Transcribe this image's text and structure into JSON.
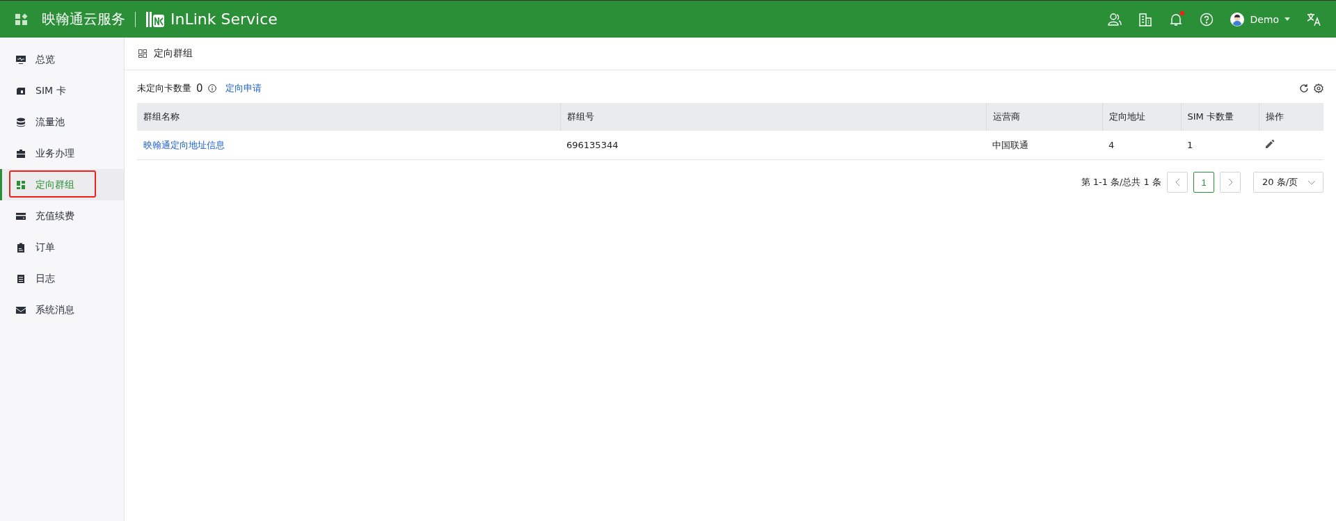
{
  "header": {
    "brand_cn": "映翰通云服务",
    "brand_en": "InLink Service",
    "notification_unread": true,
    "user": "Demo"
  },
  "sidebar": {
    "items": [
      {
        "label": "总览",
        "selected": false,
        "highlighted": false
      },
      {
        "label": "SIM 卡",
        "selected": false,
        "highlighted": false
      },
      {
        "label": "流量池",
        "selected": false,
        "highlighted": false
      },
      {
        "label": "业务办理",
        "selected": false,
        "highlighted": false
      },
      {
        "label": "定向群组",
        "selected": true,
        "highlighted": true
      },
      {
        "label": "充值续费",
        "selected": false,
        "highlighted": false
      },
      {
        "label": "订单",
        "selected": false,
        "highlighted": false
      },
      {
        "label": "日志",
        "selected": false,
        "highlighted": false
      },
      {
        "label": "系统消息",
        "selected": false,
        "highlighted": false
      }
    ]
  },
  "page_title": "定向群组",
  "toolbar": {
    "label": "未定向卡数量",
    "count": "0",
    "link": "定向申请"
  },
  "table": {
    "columns": [
      "群组名称",
      "群组号",
      "运营商",
      "定向地址",
      "SIM 卡数量",
      "操作"
    ],
    "rows": [
      {
        "name": "映翰通定向地址信息",
        "group_no": "696135344",
        "carrier": "中国联通",
        "addresses": "4",
        "sim_count": "1"
      }
    ]
  },
  "pagination": {
    "summary": "第 1-1 条/总共 1 条",
    "pages": [
      {
        "label": "1",
        "selected": true
      }
    ],
    "page_size": "20 条/页"
  }
}
